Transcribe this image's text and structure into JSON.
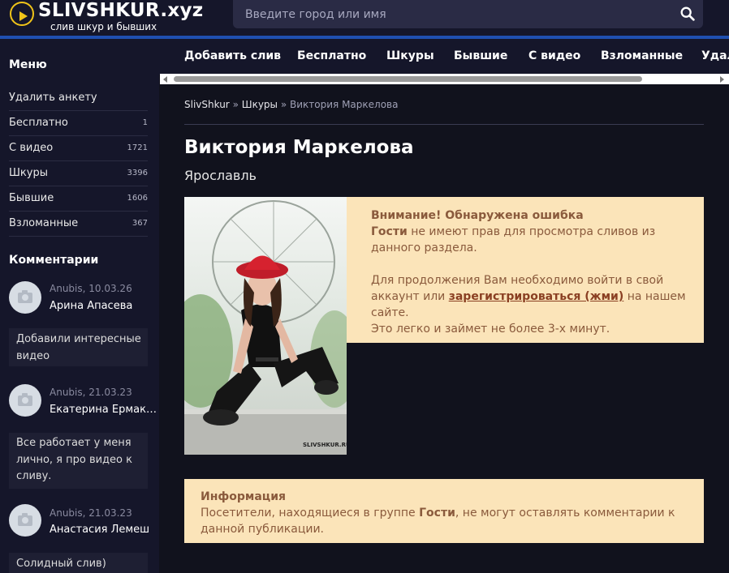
{
  "header": {
    "logo_title": "SLIVSHKUR.xyz",
    "logo_subtitle": "слив шкур и бывших",
    "search_placeholder": "Введите город или имя"
  },
  "sidebar": {
    "menu_title": "Меню",
    "menu_items": [
      {
        "label": "Удалить анкету",
        "count": ""
      },
      {
        "label": "Бесплатно",
        "count": "1"
      },
      {
        "label": "С видео",
        "count": "1721"
      },
      {
        "label": "Шкуры",
        "count": "3396"
      },
      {
        "label": "Бывшие",
        "count": "1606"
      },
      {
        "label": "Взломанные",
        "count": "367"
      }
    ],
    "comments_title": "Комментарии",
    "comments": [
      {
        "author": "Anubis",
        "date": "10.03.26",
        "post": "Арина Апасева",
        "text": "Добавили интересные видео"
      },
      {
        "author": "Anubis",
        "date": "21.03.23",
        "post": "Екатерина Ермак…",
        "text": "Все работает у меня лично, я про видео к сливу."
      },
      {
        "author": "Anubis",
        "date": "21.03.23",
        "post": "Анастасия Лемеш",
        "text": "Солидный слив)"
      }
    ]
  },
  "nav": {
    "items": [
      "Добавить слив",
      "Бесплатно",
      "Шкуры",
      "Бывшие",
      "С видео",
      "Взломанные",
      "Удал"
    ]
  },
  "breadcrumb": {
    "home": "SlivShkur",
    "sep": "»",
    "category": "Шкуры",
    "current": "Виктория Маркелова"
  },
  "profile": {
    "name": "Виктория Маркелова",
    "city": "Ярославль",
    "watermark": "SLIVSHKUR.RU"
  },
  "alert": {
    "title": "Внимание! Обнаружена ошибка",
    "guests": "Гости",
    "line1_rest": " не имеют прав для просмотра сливов из данного раздела.",
    "line2_pre": "Для продолжения Вам необходимо войти в свой аккаунт или ",
    "register_link": "зарегистрироваться (жми)",
    "line2_post": " на нашем сайте.",
    "line3": "Это легко и займет не более 3-х минут."
  },
  "info": {
    "title": "Информация",
    "text_pre": "Посетители, находящиеся в группе ",
    "guests": "Гости",
    "text_post": ", не могут оставлять комментарии к данной публикации."
  },
  "colors": {
    "background": "#11121d",
    "panel": "#15162a",
    "accent_bar": "#1f4fb0",
    "logo_yellow": "#f0c419",
    "alert_bg": "#fbe4b9",
    "alert_text": "#8a5a3c"
  }
}
